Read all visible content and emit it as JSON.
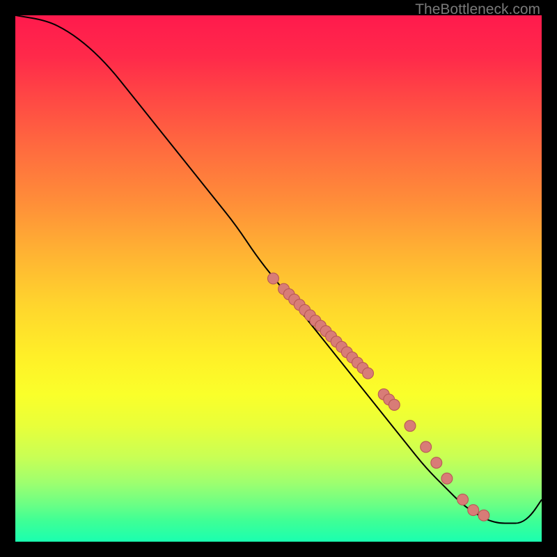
{
  "watermark": "TheBottleneck.com",
  "chart_data": {
    "type": "line",
    "title": "",
    "xlabel": "",
    "ylabel": "",
    "xlim": [
      0,
      100
    ],
    "ylim": [
      0,
      100
    ],
    "curve": {
      "x": [
        0,
        6,
        10,
        14,
        18,
        22,
        26,
        30,
        34,
        38,
        42,
        46,
        50,
        54,
        58,
        62,
        66,
        70,
        74,
        78,
        82,
        85,
        88,
        90,
        92,
        94,
        96,
        98,
        100
      ],
      "y": [
        100,
        99,
        97,
        94,
        90,
        85,
        80,
        75,
        70,
        65,
        60,
        54,
        49,
        44,
        39,
        34,
        29,
        24,
        19,
        14,
        10,
        7,
        5,
        4,
        3.5,
        3.5,
        3.5,
        5,
        8
      ]
    },
    "markers": {
      "x": [
        49,
        51,
        52,
        53,
        54,
        55,
        56,
        57,
        58,
        59,
        60,
        61,
        62,
        63,
        64,
        65,
        66,
        67,
        70,
        71,
        72,
        75,
        78,
        80,
        82,
        85,
        87,
        89
      ],
      "y": [
        50,
        48,
        47,
        46,
        45,
        44,
        43,
        42,
        41,
        40,
        39,
        38,
        37,
        36,
        35,
        34,
        33,
        32,
        28,
        27,
        26,
        22,
        18,
        15,
        12,
        8,
        6,
        5
      ]
    },
    "colors": {
      "curve": "#000000",
      "marker_fill": "#d87c77",
      "marker_stroke": "#b85a55"
    }
  }
}
